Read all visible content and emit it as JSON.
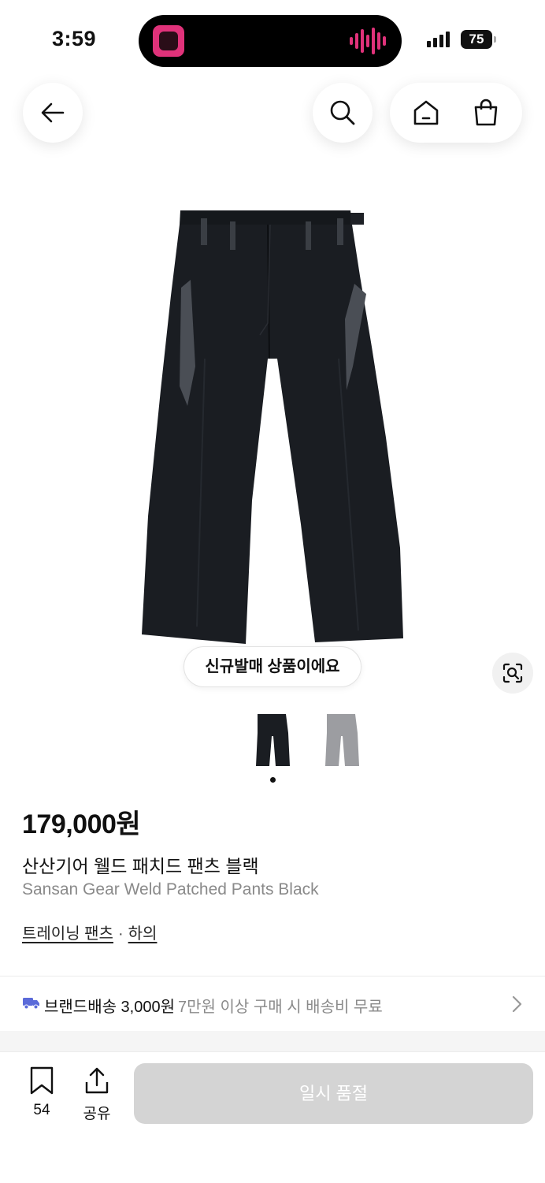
{
  "status_bar": {
    "time": "3:59",
    "battery": "75"
  },
  "product": {
    "badge": "신규발매 상품이에요",
    "price": "179,000원",
    "name_ko": "산산기어 웰드 패치드 팬츠 블랙",
    "name_en": "Sansan Gear Weld Patched Pants Black",
    "categories": [
      "트레이닝 팬츠",
      "하의"
    ],
    "category_separator": "·",
    "colors": [
      "#1a1d22",
      "#9c9da1"
    ]
  },
  "shipping": {
    "label": "브랜드배송 3,000원",
    "note": "7만원 이상 구매 시 배송비 무료"
  },
  "bottom_bar": {
    "bookmark_count": "54",
    "share_label": "공유",
    "cta_label": "일시 품절"
  },
  "icons": [
    "back-arrow-icon",
    "search-icon",
    "home-icon",
    "shopping-bag-icon",
    "lens-search-icon",
    "truck-icon",
    "chevron-right-icon",
    "bookmark-icon",
    "share-icon"
  ]
}
